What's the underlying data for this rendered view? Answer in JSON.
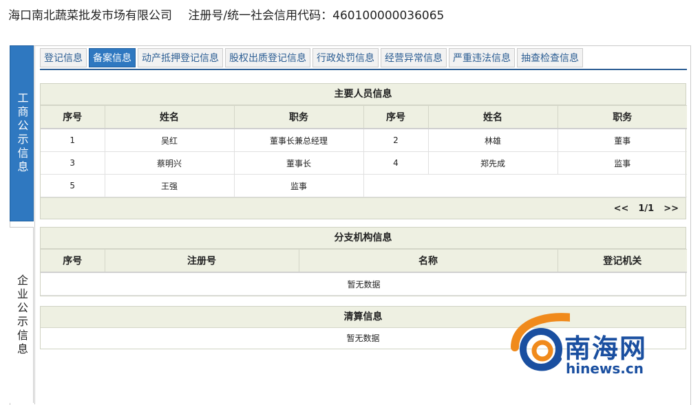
{
  "header": {
    "company": "海口南北蔬菜批发市场有限公司",
    "reg_label": "注册号/统一社会信用代码：460100000036065"
  },
  "side_tabs": [
    {
      "label": "工商公示信息"
    },
    {
      "label": "企业公示信息"
    }
  ],
  "tabs": [
    {
      "label": "登记信息"
    },
    {
      "label": "备案信息"
    },
    {
      "label": "动产抵押登记信息"
    },
    {
      "label": "股权出质登记信息"
    },
    {
      "label": "行政处罚信息"
    },
    {
      "label": "经营异常信息"
    },
    {
      "label": "严重违法信息"
    },
    {
      "label": "抽查检查信息"
    }
  ],
  "personnel": {
    "title": "主要人员信息",
    "headers": [
      "序号",
      "姓名",
      "职务",
      "序号",
      "姓名",
      "职务"
    ],
    "rows": [
      [
        "1",
        "吴红",
        "董事长兼总经理",
        "2",
        "林雄",
        "董事"
      ],
      [
        "3",
        "蔡明兴",
        "董事长",
        "4",
        "郑先成",
        "监事"
      ],
      [
        "5",
        "王强",
        "监事",
        "",
        "",
        ""
      ]
    ],
    "pager": {
      "prev": "<<",
      "page": "1/1",
      "next": ">>"
    }
  },
  "branch": {
    "title": "分支机构信息",
    "headers": [
      "序号",
      "注册号",
      "名称",
      "登记机关"
    ],
    "empty": "暂无数据"
  },
  "liquidation": {
    "title": "清算信息",
    "empty": "暂无数据"
  },
  "watermark": {
    "cn": "南海网",
    "en": "hinews.cn",
    "colors": {
      "orange": "#f08a1c",
      "blue": "#1a4fa0"
    }
  }
}
